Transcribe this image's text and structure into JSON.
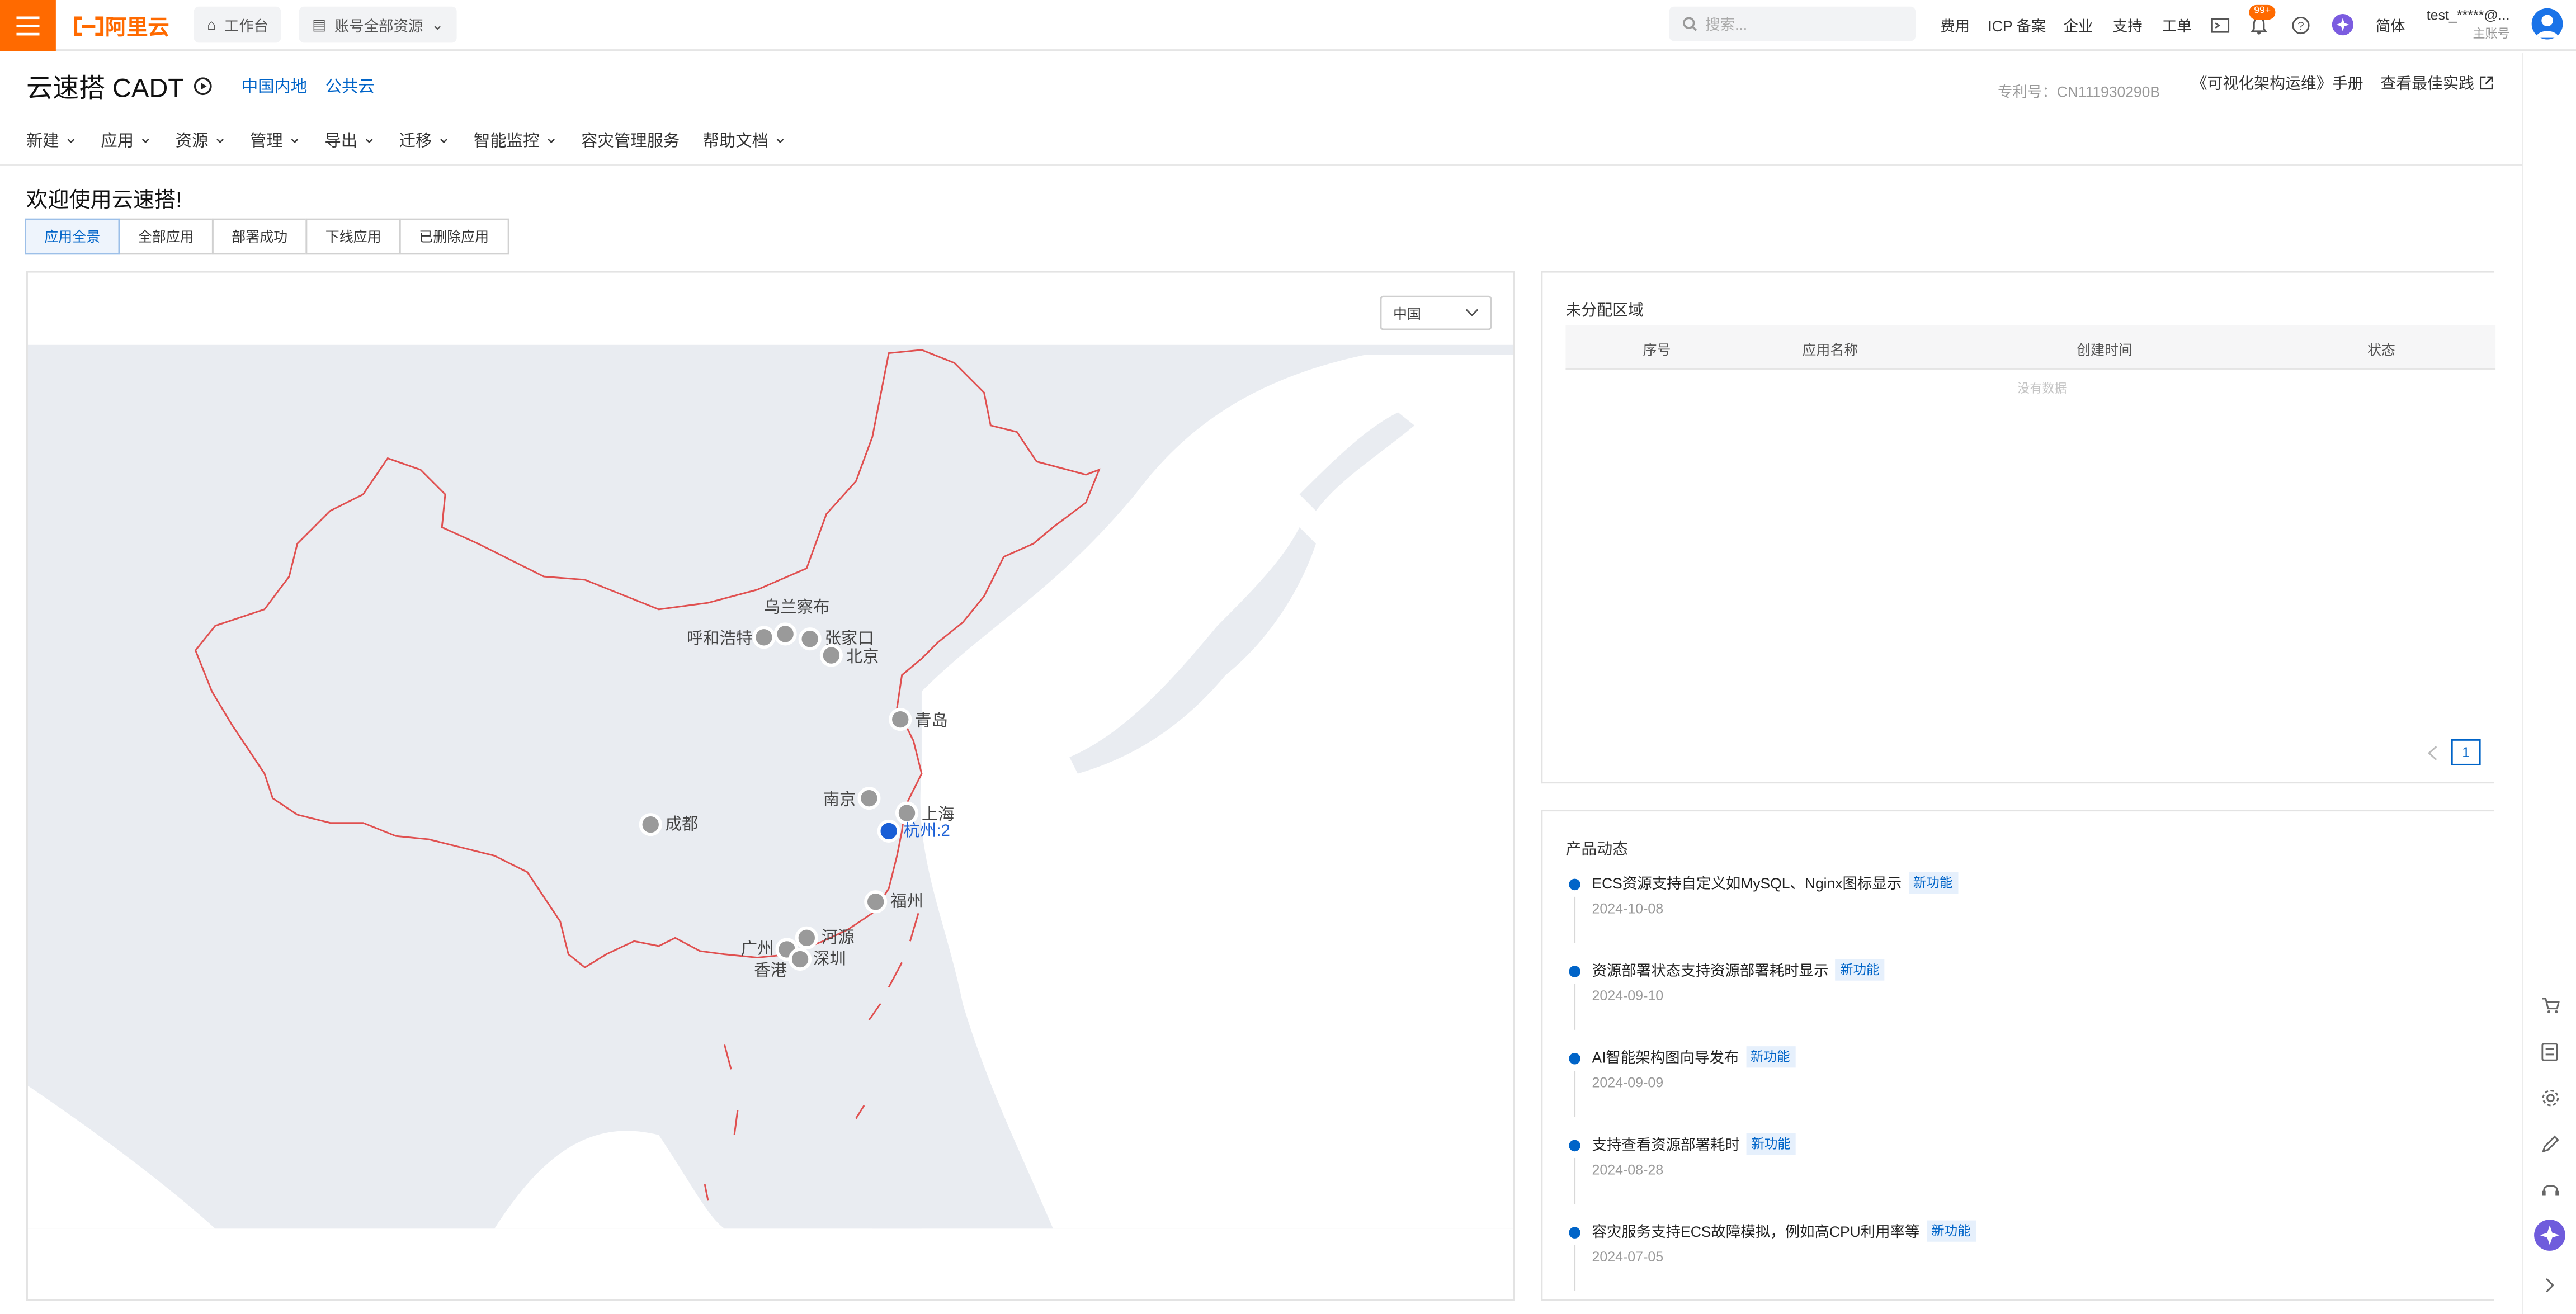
{
  "topbar": {
    "logo_text": "阿里云",
    "workbench": "工作台",
    "resource_scope": "账号全部资源",
    "search_placeholder": "搜索...",
    "links": [
      "费用",
      "ICP 备案",
      "企业",
      "支持",
      "工单"
    ],
    "notification_count": "99+",
    "language": "简体",
    "user_name": "test_*****@...",
    "user_role": "主账号"
  },
  "header": {
    "title": "云速搭 CADT",
    "regions": [
      "中国内地",
      "公共云"
    ],
    "patent": "专利号：CN111930290B",
    "manual": "《可视化架构运维》手册",
    "best_practice": "查看最佳实践"
  },
  "nav": [
    "新建",
    "应用",
    "资源",
    "管理",
    "导出",
    "迁移",
    "智能监控",
    "容灾管理服务",
    "帮助文档"
  ],
  "welcome": "欢迎使用云速搭!",
  "tabs": [
    "应用全景",
    "全部应用",
    "部署成功",
    "下线应用",
    "已删除应用"
  ],
  "map": {
    "region_select": "中国",
    "cities": [
      "乌兰察布",
      "呼和浩特",
      "张家口",
      "北京",
      "青岛",
      "南京",
      "上海",
      "杭州:2",
      "成都",
      "福州",
      "河源",
      "广州",
      "深圳",
      "香港"
    ]
  },
  "unassigned": {
    "title": "未分配区域",
    "columns": [
      "序号",
      "应用名称",
      "创建时间",
      "状态"
    ],
    "empty_text": "没有数据",
    "page": "1"
  },
  "news": {
    "title": "产品动态",
    "items": [
      {
        "text": "ECS资源支持自定义如MySQL、Nginx图标显示",
        "tag": "新功能",
        "date": "2024-10-08"
      },
      {
        "text": "资源部署状态支持资源部署耗时显示",
        "tag": "新功能",
        "date": "2024-09-10"
      },
      {
        "text": "AI智能架构图向导发布",
        "tag": "新功能",
        "date": "2024-09-09"
      },
      {
        "text": "支持查看资源部署耗时",
        "tag": "新功能",
        "date": "2024-08-28"
      },
      {
        "text": "容灾服务支持ECS故障模拟，例如高CPU利用率等",
        "tag": "新功能",
        "date": "2024-07-05"
      }
    ]
  },
  "colors": {
    "brand": "#ff6a00",
    "link": "#0064c8",
    "border_red": "#e05050"
  }
}
